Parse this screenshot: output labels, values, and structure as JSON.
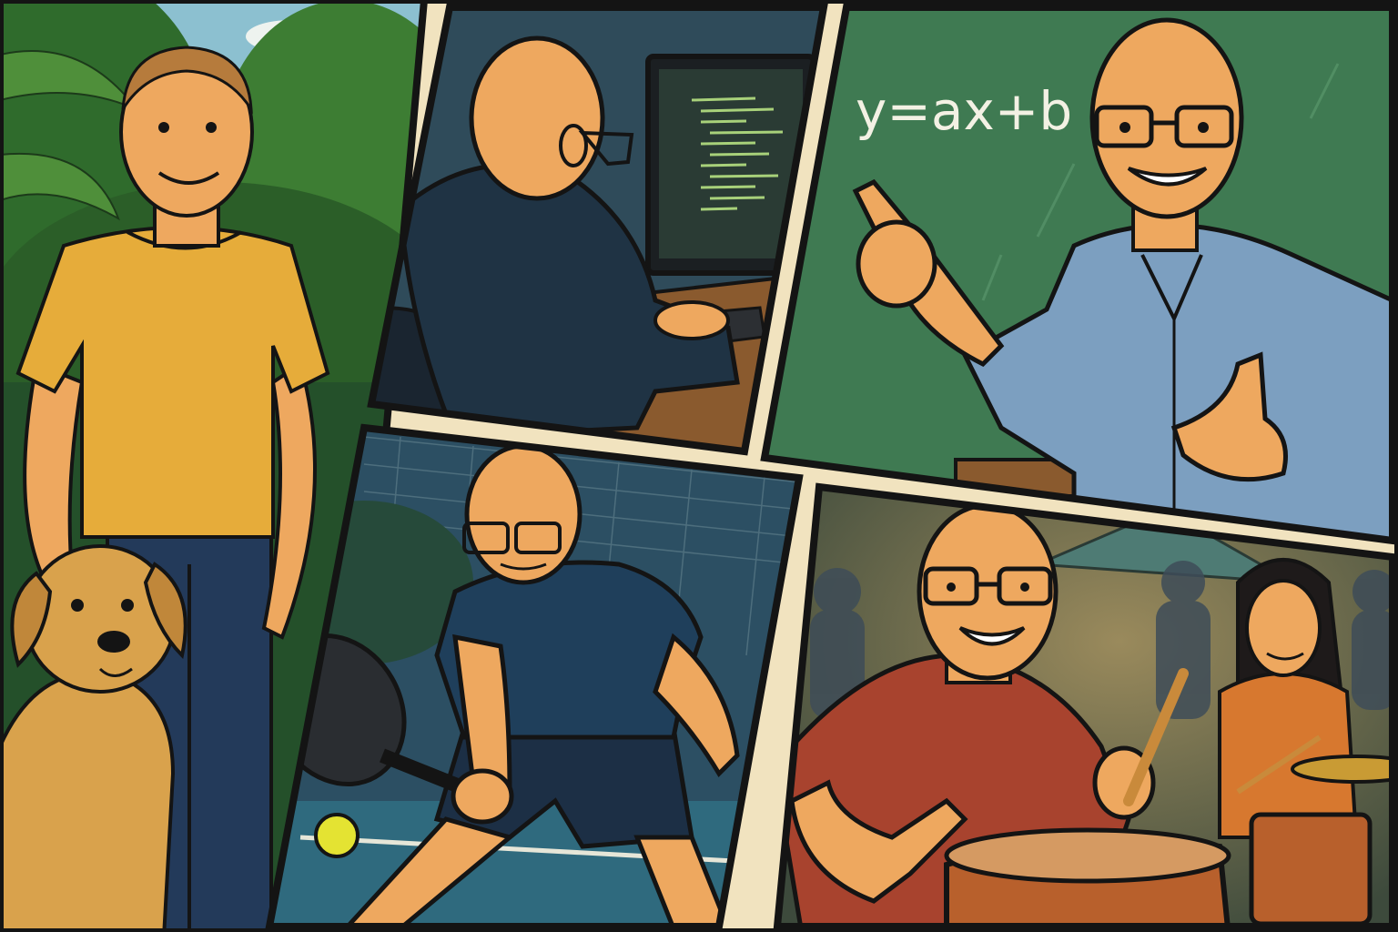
{
  "comic": {
    "panels": [
      {
        "id": "park",
        "subject": "man-with-dog"
      },
      {
        "id": "coding",
        "subject": "man-at-computer"
      },
      {
        "id": "teaching",
        "subject": "man-at-chalkboard"
      },
      {
        "id": "padel",
        "subject": "man-playing-padel"
      },
      {
        "id": "drums",
        "subject": "man-playing-drums"
      }
    ],
    "chalkboard_equation": "y=ax+b"
  },
  "colors": {
    "gutter": "#f1e3bf",
    "outline": "#141414",
    "skin": "#eea85f",
    "yellow_shirt": "#e6ac3a",
    "hoodie": "#1f3344",
    "chalkboard": "#3f7a52",
    "blue_shirt": "#7c9fc0",
    "red_shirt": "#a8432e",
    "navy_shirt": "#1f3f5b",
    "dog": "#d9a24c"
  }
}
